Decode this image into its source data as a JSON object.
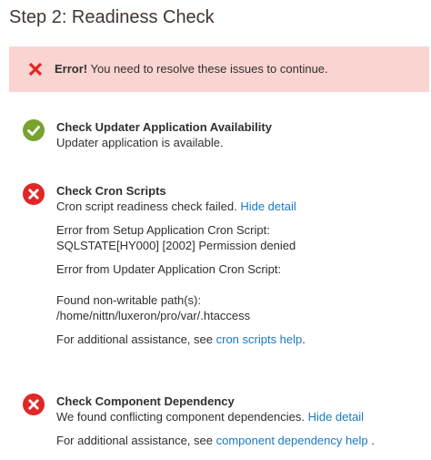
{
  "page": {
    "title": "Step 2: Readiness Check"
  },
  "banner": {
    "strong": "Error!",
    "message": " You need to resolve these issues to continue."
  },
  "checks": [
    {
      "title": "Check Updater Application Availability",
      "status": "success",
      "message": "Updater application is available."
    },
    {
      "title": "Check Cron Scripts",
      "status": "error",
      "message": "Cron script readiness check failed.",
      "detail_link": "Hide detail",
      "setup_error_label": "Error from Setup Application Cron Script:",
      "setup_error_value": "SQLSTATE[HY000] [2002] Permission denied",
      "updater_error_label": "Error from Updater Application Cron Script:",
      "nonwritable_label": "Found non-writable path(s):",
      "nonwritable_path": "/home/nittn/luxeron/pro/var/.htaccess",
      "assist_prefix": "For additional assistance, see ",
      "assist_link": "cron scripts help",
      "assist_suffix": "."
    },
    {
      "title": "Check Component Dependency",
      "status": "error",
      "message": "We found conflicting component dependencies.",
      "detail_link": "Hide detail",
      "assist_prefix": "For additional assistance, see ",
      "assist_link": "component dependency help",
      "assist_suffix": " ."
    }
  ],
  "colors": {
    "success": "#79a22e",
    "error": "#e22626",
    "banner_bg": "#fad4d1",
    "link": "#1979c3"
  }
}
